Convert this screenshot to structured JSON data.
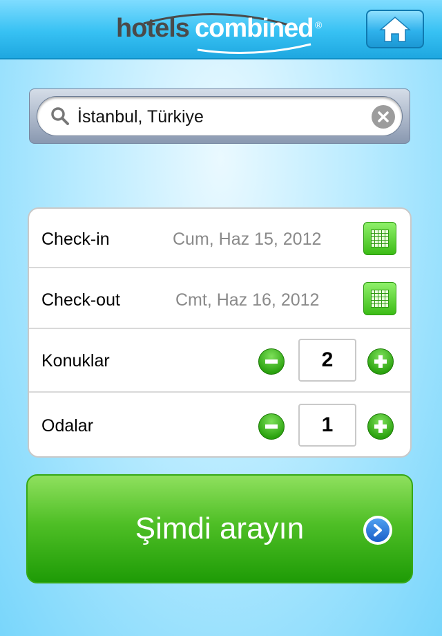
{
  "header": {
    "brand_part1": "hotels",
    "brand_part2": "combined",
    "brand_reg": "®",
    "home_icon": "home-icon"
  },
  "search": {
    "value": "İstanbul, Türkiye",
    "search_icon": "search-icon",
    "clear_icon": "clear-icon"
  },
  "form": {
    "checkin": {
      "label": "Check-in",
      "date": "Cum, Haz 15, 2012",
      "icon": "calendar-icon"
    },
    "checkout": {
      "label": "Check-out",
      "date": "Cmt, Haz 16, 2012",
      "icon": "calendar-icon"
    },
    "guests": {
      "label": "Konuklar",
      "value": "2"
    },
    "rooms": {
      "label": "Odalar",
      "value": "1"
    }
  },
  "action": {
    "search_label": "Şimdi arayın",
    "arrow_icon": "chevron-right-icon"
  },
  "colors": {
    "header_blue": "#37c1f3",
    "button_green": "#4fbf26",
    "background_blue": "#b9ebff"
  }
}
